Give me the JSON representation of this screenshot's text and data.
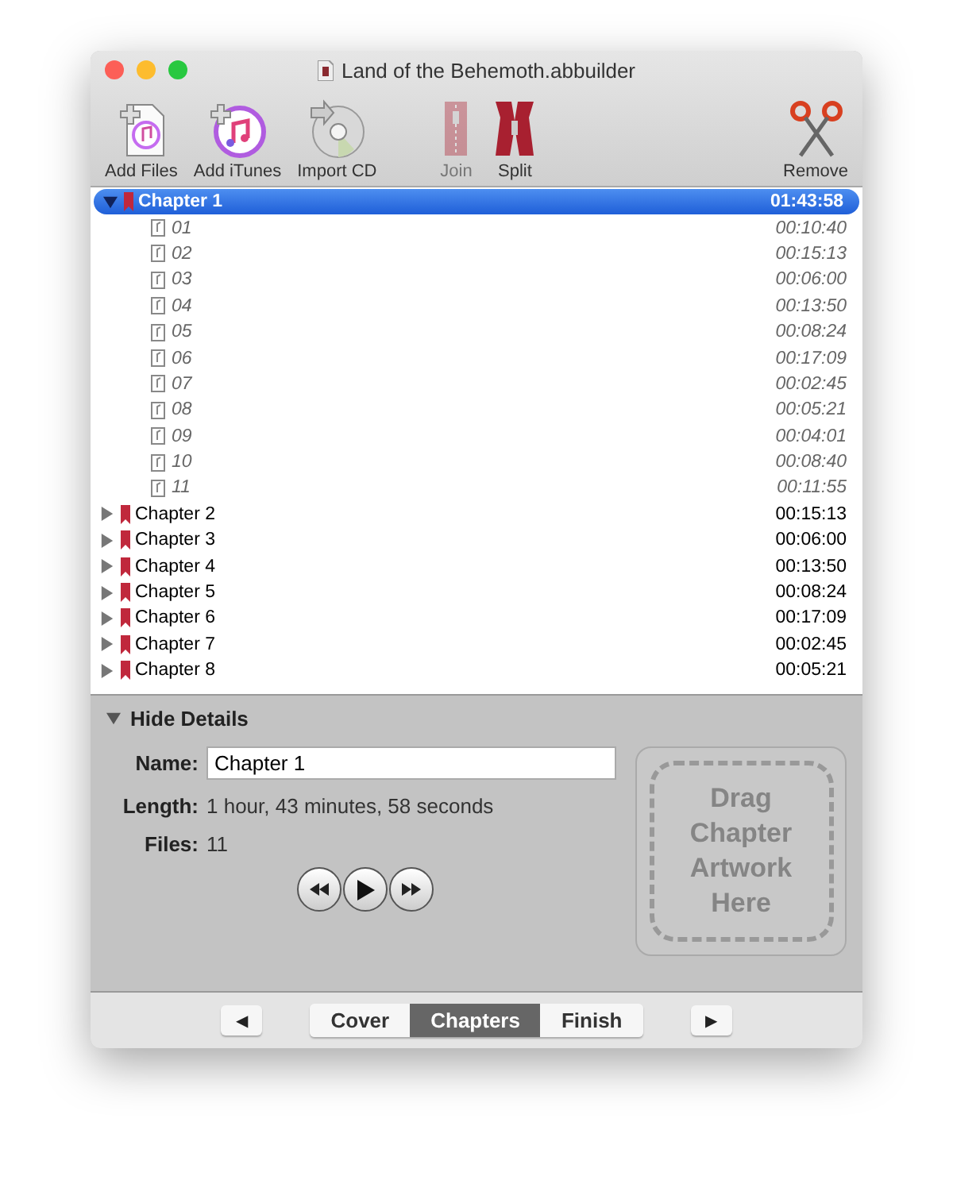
{
  "window": {
    "title": "Land of the Behemoth.abbuilder"
  },
  "toolbar": [
    {
      "label": "Add Files",
      "kind": "addfiles"
    },
    {
      "label": "Add iTunes",
      "kind": "itunes"
    },
    {
      "label": "Import CD",
      "kind": "cd"
    },
    {
      "label": "Join",
      "kind": "join",
      "disabled": true
    },
    {
      "label": "Split",
      "kind": "split",
      "disabled": false
    },
    {
      "label": "Remove",
      "kind": "remove",
      "disabled": false
    }
  ],
  "chapters": [
    {
      "name": "Chapter 1",
      "duration": "01:43:58",
      "selected": true,
      "expanded": true,
      "children": [
        {
          "name": "01",
          "duration": "00:10:40"
        },
        {
          "name": "02",
          "duration": "00:15:13"
        },
        {
          "name": "03",
          "duration": "00:06:00"
        },
        {
          "name": "04",
          "duration": "00:13:50"
        },
        {
          "name": "05",
          "duration": "00:08:24"
        },
        {
          "name": "06",
          "duration": "00:17:09"
        },
        {
          "name": "07",
          "duration": "00:02:45"
        },
        {
          "name": "08",
          "duration": "00:05:21"
        },
        {
          "name": "09",
          "duration": "00:04:01"
        },
        {
          "name": "10",
          "duration": "00:08:40"
        },
        {
          "name": "11",
          "duration": "00:11:55"
        }
      ]
    },
    {
      "name": "Chapter 2",
      "duration": "00:15:13",
      "selected": false,
      "expanded": false
    },
    {
      "name": "Chapter 3",
      "duration": "00:06:00",
      "selected": false,
      "expanded": false
    },
    {
      "name": "Chapter 4",
      "duration": "00:13:50",
      "selected": false,
      "expanded": false
    },
    {
      "name": "Chapter 5",
      "duration": "00:08:24",
      "selected": false,
      "expanded": false
    },
    {
      "name": "Chapter 6",
      "duration": "00:17:09",
      "selected": false,
      "expanded": false
    },
    {
      "name": "Chapter 7",
      "duration": "00:02:45",
      "selected": false,
      "expanded": false
    },
    {
      "name": "Chapter 8",
      "duration": "00:05:21",
      "selected": false,
      "expanded": false
    }
  ],
  "details": {
    "toggle": "Hide Details",
    "expanded": true,
    "fields": [
      {
        "label": "Name:",
        "value": "Chapter 1",
        "kind": "input"
      },
      {
        "label": "Length:",
        "value": "1 hour, 43 minutes, 58 seconds",
        "kind": "text"
      },
      {
        "label": "Files:",
        "value": "11",
        "kind": "text"
      }
    ],
    "artwork_placeholder": "Drag Chapter Artwork Here"
  },
  "steps": {
    "back": "◀",
    "next": "▶",
    "tabs": [
      {
        "label": "Cover",
        "selected": false
      },
      {
        "label": "Chapters",
        "selected": true
      },
      {
        "label": "Finish",
        "selected": false
      }
    ]
  }
}
